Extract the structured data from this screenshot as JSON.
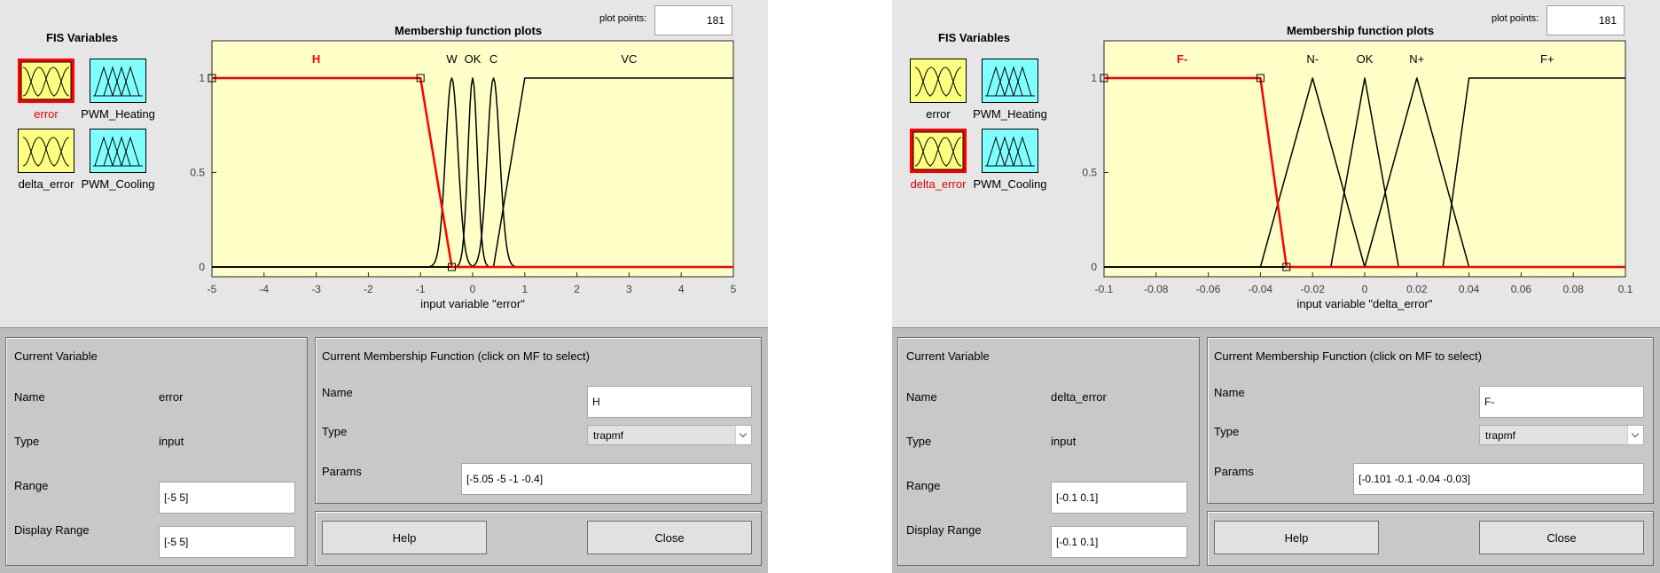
{
  "colors": {
    "plot_bg": "#ffffc8",
    "selected": "#ff0000",
    "input_icon": "#ffff80",
    "output_icon": "#80ffff",
    "panel_bottom": "#c8c8c8"
  },
  "panels": [
    {
      "fis": {
        "title": "FIS Variables",
        "variables": [
          {
            "label": "error",
            "kind": "input",
            "selected": true,
            "icon": "input-mf-icon"
          },
          {
            "label": "PWM_Heating",
            "kind": "output",
            "selected": false,
            "icon": "output-mf-icon"
          },
          {
            "label": "delta_error",
            "kind": "input",
            "selected": false,
            "icon": "input-mf-icon"
          },
          {
            "label": "PWM_Cooling",
            "kind": "output",
            "selected": false,
            "icon": "output-mf-icon"
          }
        ]
      },
      "plot": {
        "title": "Membership function plots",
        "plot_points_label": "plot points:",
        "plot_points_value": "181",
        "xlabel": "input variable \"error\""
      },
      "chart_data": {
        "type": "line",
        "xlim": [
          -5,
          5
        ],
        "ylim": [
          0,
          1
        ],
        "xticks": [
          "-5",
          "-4",
          "-3",
          "-2",
          "-1",
          "0",
          "1",
          "2",
          "3",
          "4",
          "5"
        ],
        "yticks": [
          "0",
          "0.5",
          "1"
        ],
        "mfs": [
          {
            "name": "H",
            "mf": "trapmf",
            "params": [
              -5.05,
              -5,
              -1,
              -0.4
            ],
            "selected": true
          },
          {
            "name": "W",
            "mf": "gaussmf",
            "params": [
              0.12,
              -0.4
            ],
            "selected": false
          },
          {
            "name": "OK",
            "mf": "gaussmf",
            "params": [
              0.09,
              0
            ],
            "selected": false
          },
          {
            "name": "C",
            "mf": "gaussmf",
            "params": [
              0.12,
              0.4
            ],
            "selected": false
          },
          {
            "name": "VC",
            "mf": "trapmf",
            "params": [
              0.4,
              1,
              5,
              5.05
            ],
            "selected": false
          }
        ],
        "mf_label_positions": [
          -3,
          -0.4,
          0,
          0.4,
          3
        ]
      },
      "current_variable": {
        "title": "Current Variable",
        "name_label": "Name",
        "name_value": "error",
        "type_label": "Type",
        "type_value": "input",
        "range_label": "Range",
        "range_value": "[-5 5]",
        "display_range_label": "Display Range",
        "display_range_value": "[-5 5]"
      },
      "current_mf": {
        "title": "Current Membership Function (click on MF to select)",
        "name_label": "Name",
        "name_value": "H",
        "type_label": "Type",
        "type_value": "trapmf",
        "params_label": "Params",
        "params_value": "[-5.05 -5 -1 -0.4]"
      },
      "buttons": {
        "help": "Help",
        "close": "Close"
      }
    },
    {
      "fis": {
        "title": "FIS Variables",
        "variables": [
          {
            "label": "error",
            "kind": "input",
            "selected": false,
            "icon": "input-mf-icon"
          },
          {
            "label": "PWM_Heating",
            "kind": "output",
            "selected": false,
            "icon": "output-mf-icon"
          },
          {
            "label": "delta_error",
            "kind": "input",
            "selected": true,
            "icon": "input-mf-icon"
          },
          {
            "label": "PWM_Cooling",
            "kind": "output",
            "selected": false,
            "icon": "output-mf-icon"
          }
        ]
      },
      "plot": {
        "title": "Membership function plots",
        "plot_points_label": "plot points:",
        "plot_points_value": "181",
        "xlabel": "input variable \"delta_error\""
      },
      "chart_data": {
        "type": "line",
        "xlim": [
          -0.1,
          0.1
        ],
        "ylim": [
          0,
          1
        ],
        "xticks": [
          "-0.1",
          "-0.08",
          "-0.06",
          "-0.04",
          "-0.02",
          "0",
          "0.02",
          "0.04",
          "0.06",
          "0.08",
          "0.1"
        ],
        "yticks": [
          "0",
          "0.5",
          "1"
        ],
        "mfs": [
          {
            "name": "F-",
            "mf": "trapmf",
            "params": [
              -0.101,
              -0.1,
              -0.04,
              -0.03
            ],
            "selected": true
          },
          {
            "name": "N-",
            "mf": "trimf",
            "params": [
              -0.04,
              -0.02,
              0
            ],
            "selected": false
          },
          {
            "name": "OK",
            "mf": "trimf",
            "params": [
              -0.013,
              0,
              0.013
            ],
            "selected": false
          },
          {
            "name": "N+",
            "mf": "trimf",
            "params": [
              0,
              0.02,
              0.04
            ],
            "selected": false
          },
          {
            "name": "F+",
            "mf": "trapmf",
            "params": [
              0.03,
              0.04,
              0.1,
              0.101
            ],
            "selected": false
          }
        ],
        "mf_label_positions": [
          -0.07,
          -0.02,
          0,
          0.02,
          0.07
        ]
      },
      "current_variable": {
        "title": "Current Variable",
        "name_label": "Name",
        "name_value": "delta_error",
        "type_label": "Type",
        "type_value": "input",
        "range_label": "Range",
        "range_value": "[-0.1 0.1]",
        "display_range_label": "Display Range",
        "display_range_value": "[-0.1 0.1]"
      },
      "current_mf": {
        "title": "Current Membership Function (click on MF to select)",
        "name_label": "Name",
        "name_value": "F-",
        "type_label": "Type",
        "type_value": "trapmf",
        "params_label": "Params",
        "params_value": "[-0.101 -0.1 -0.04 -0.03]"
      },
      "buttons": {
        "help": "Help",
        "close": "Close"
      }
    }
  ]
}
